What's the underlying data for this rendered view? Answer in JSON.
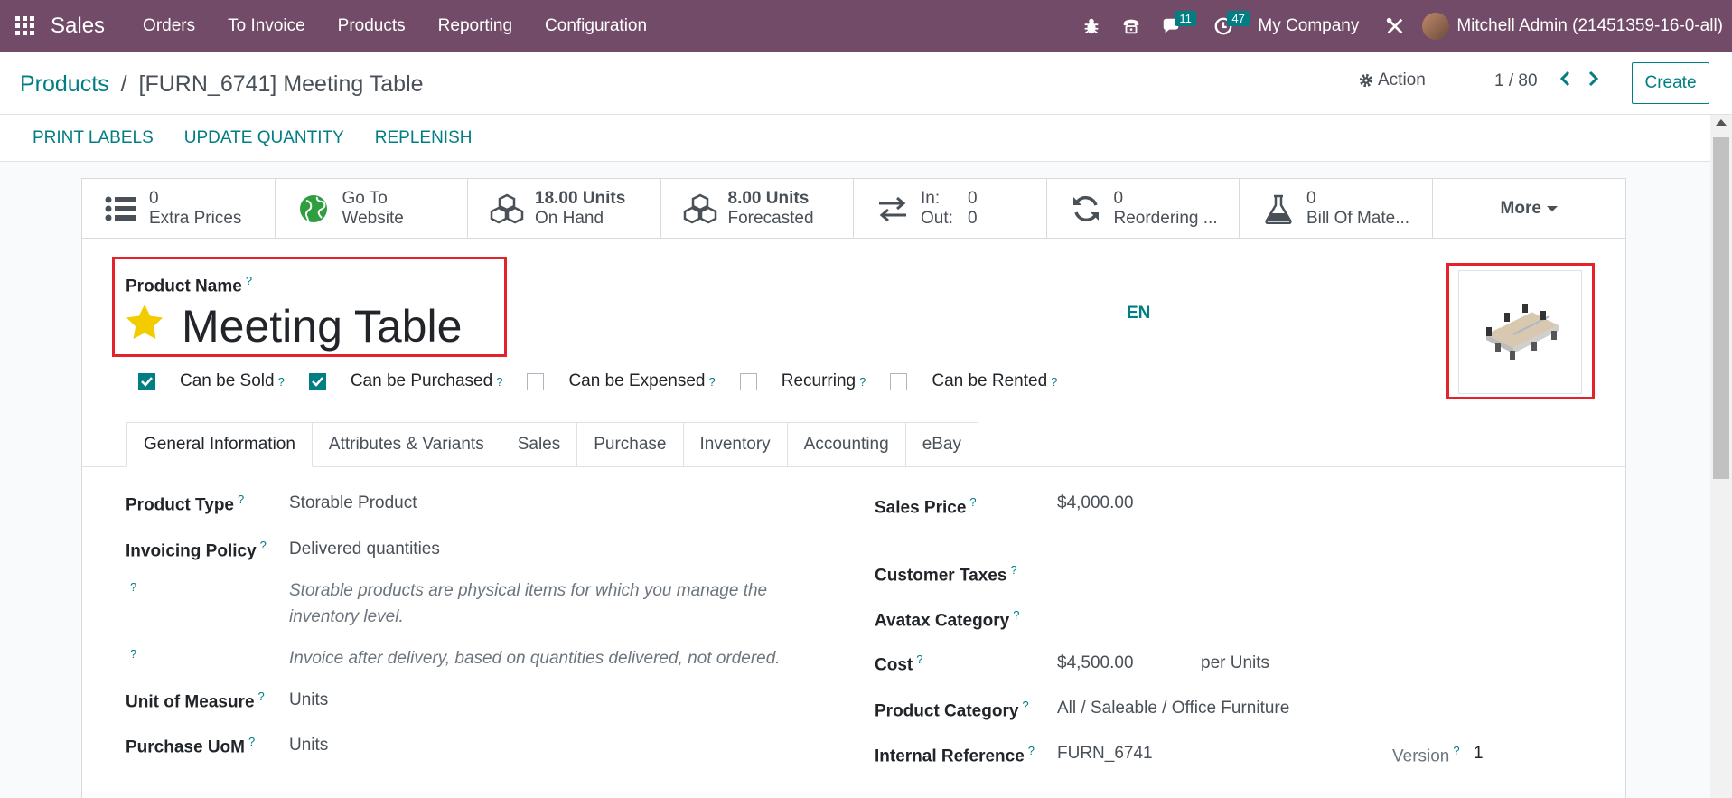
{
  "navbar": {
    "brand": "Sales",
    "menu": [
      "Orders",
      "To Invoice",
      "Products",
      "Reporting",
      "Configuration"
    ],
    "messages_badge": "11",
    "activities_badge": "47",
    "company": "My Company",
    "user": "Mitchell Admin (21451359-16-0-all)",
    "color": "#714B67"
  },
  "control": {
    "breadcrumb_root": "Products",
    "breadcrumb_sep": "/",
    "breadcrumb_current": "[FURN_6741] Meeting Table",
    "action_label": "Action",
    "pager": "1 / 80",
    "create_label": "Create"
  },
  "statusbar": {
    "buttons": [
      "PRINT LABELS",
      "UPDATE QUANTITY",
      "REPLENISH"
    ]
  },
  "smart_buttons": {
    "extra_prices": {
      "value": "0",
      "label": "Extra Prices"
    },
    "website": {
      "value": "Go To",
      "label": "Website"
    },
    "on_hand": {
      "value": "18.00 Units",
      "label": "On Hand"
    },
    "forecasted": {
      "value": "8.00 Units",
      "label": "Forecasted"
    },
    "inout": {
      "in_label": "In:",
      "in_value": "0",
      "out_label": "Out:",
      "out_value": "0"
    },
    "reordering": {
      "value": "0",
      "label": "Reordering ..."
    },
    "bom": {
      "value": "0",
      "label": "Bill Of Mate..."
    },
    "more": "More"
  },
  "product": {
    "name_label": "Product Name",
    "help_mark": "?",
    "name": "Meeting Table",
    "lang": "EN",
    "checkboxes": [
      {
        "label": "Can be Sold",
        "checked": true
      },
      {
        "label": "Can be Purchased",
        "checked": true
      },
      {
        "label": "Can be Expensed",
        "checked": false
      },
      {
        "label": "Recurring",
        "checked": false
      },
      {
        "label": "Can be Rented",
        "checked": false
      }
    ]
  },
  "tabs": [
    "General Information",
    "Attributes & Variants",
    "Sales",
    "Purchase",
    "Inventory",
    "Accounting",
    "eBay"
  ],
  "general": {
    "left": {
      "product_type_label": "Product Type",
      "product_type": "Storable Product",
      "invoicing_policy_label": "Invoicing Policy",
      "invoicing_policy": "Delivered quantities",
      "help1_line1": "Storable products are physical items for which you manage the",
      "help1_line2": "inventory level.",
      "help2": "Invoice after delivery, based on quantities delivered, not ordered.",
      "uom_label": "Unit of Measure",
      "uom": "Units",
      "purchase_uom_label": "Purchase UoM",
      "purchase_uom": "Units"
    },
    "right": {
      "sales_price_label": "Sales Price",
      "sales_price": "$4,000.00",
      "customer_taxes_label": "Customer Taxes",
      "avatax_label": "Avatax Category",
      "cost_label": "Cost",
      "cost": "$4,500.00",
      "cost_unit": "per Units",
      "category_label": "Product Category",
      "category": "All / Saleable / Office Furniture",
      "internal_ref_label": "Internal Reference",
      "internal_ref": "FURN_6741",
      "version_label": "Version",
      "version": "1"
    }
  },
  "colors": {
    "accent": "#017E84",
    "highlight": "#E5212A",
    "star": "#F3CC00"
  }
}
